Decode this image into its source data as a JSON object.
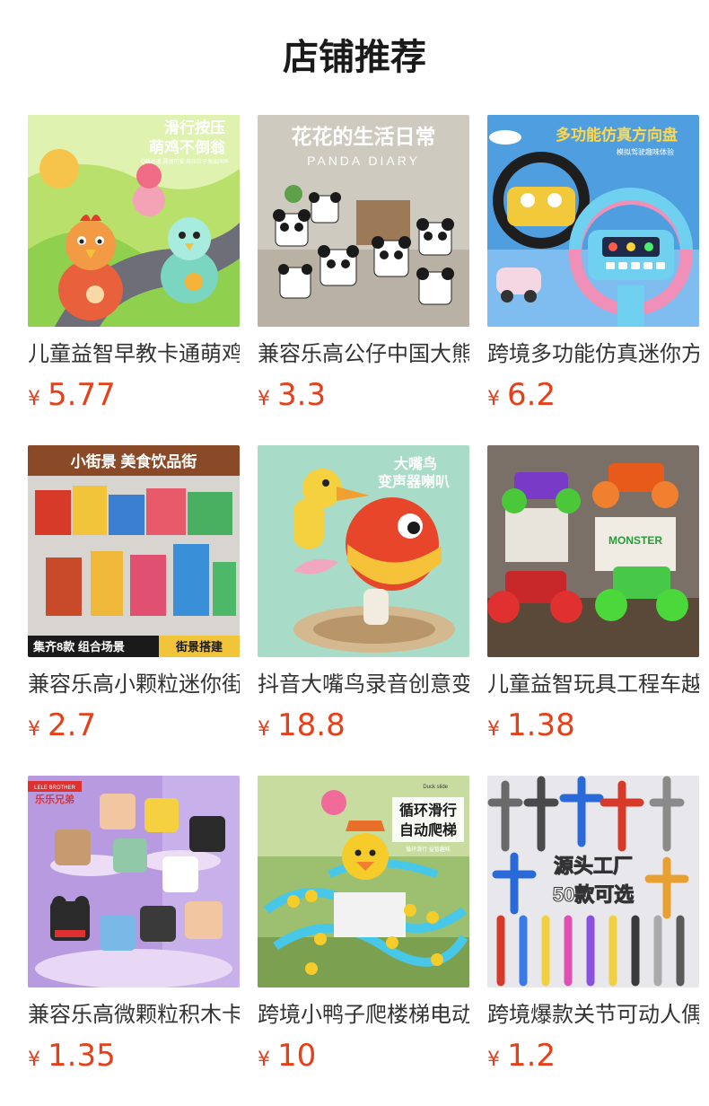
{
  "header": {
    "title": "店铺推荐"
  },
  "theme": {
    "price_color": "#e5401a"
  },
  "products": [
    {
      "name": "儿童益智早教卡通萌鸡不倒翁",
      "currency": "¥",
      "price": "5.77",
      "image": {
        "icon": "tumbler-chick-toy-image",
        "text_lines": [
          "滑行按压",
          "萌鸡不倒翁"
        ],
        "caption": "Q萌出道,圆润可爱,按压肚子发出叫声"
      }
    },
    {
      "name": "兼容乐高公仔中国大熊猫积木",
      "currency": "¥",
      "price": "3.3",
      "image": {
        "icon": "panda-blocks-image",
        "text_lines": [
          "花花的生活日常",
          "PANDA DIARY"
        ]
      }
    },
    {
      "name": "跨境多功能仿真迷你方向盘",
      "currency": "¥",
      "price": "6.2",
      "image": {
        "icon": "steering-wheel-toy-image",
        "text_lines": [
          "多功能仿真方向盘",
          "模拟驾驶趣味体验"
        ]
      }
    },
    {
      "name": "兼容乐高小颗粒迷你街景积木",
      "currency": "¥",
      "price": "2.7",
      "image": {
        "icon": "street-view-blocks-image",
        "text_lines": [
          "小街景 美食饮品街",
          "集齐8款 组合场景",
          "街景搭建"
        ]
      }
    },
    {
      "name": "抖音大嘴鸟录音创意变声器",
      "currency": "¥",
      "price": "18.8",
      "image": {
        "icon": "big-mouth-bird-toy-image",
        "text_lines": [
          "大嘴鸟",
          "变声器喇叭"
        ]
      }
    },
    {
      "name": "儿童益智玩具工程车越野车",
      "currency": "¥",
      "price": "1.38",
      "image": {
        "icon": "monster-truck-toys-image",
        "text_lines": [
          "MONSTER"
        ]
      }
    },
    {
      "name": "兼容乐高微颗粒积木卡通公仔",
      "currency": "¥",
      "price": "1.35",
      "image": {
        "icon": "cartoon-figure-blocks-image",
        "text_lines": [
          "LELE BROTHER",
          "乐乐兄弟"
        ]
      }
    },
    {
      "name": "跨境小鸭子爬楼梯电动滑梯",
      "currency": "¥",
      "price": "10",
      "image": {
        "icon": "duck-slide-track-image",
        "text_lines": [
          "循环滑行",
          "自动爬梯",
          "Duck slide"
        ],
        "caption": "循环滑行 益智趣味"
      }
    },
    {
      "name": "跨境爆款关节可动人偶模型",
      "currency": "¥",
      "price": "1.2",
      "image": {
        "icon": "articulated-figures-image",
        "text_lines": [
          "源头工厂",
          "50款可选"
        ]
      }
    }
  ]
}
